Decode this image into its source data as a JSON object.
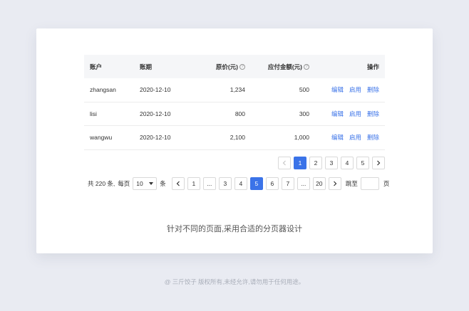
{
  "table": {
    "headers": {
      "account": "账户",
      "period": "账期",
      "original_price": "原价(元)",
      "payable": "应付金额(元)",
      "actions": "操作"
    },
    "help_icon": "question-circle-icon",
    "rows": [
      {
        "account": "zhangsan",
        "period": "2020-12-10",
        "original_price": "1,234",
        "payable": "500"
      },
      {
        "account": "lisi",
        "period": "2020-12-10",
        "original_price": "800",
        "payable": "300"
      },
      {
        "account": "wangwu",
        "period": "2020-12-10",
        "original_price": "2,100",
        "payable": "1,000"
      }
    ],
    "action_labels": {
      "edit": "编辑",
      "enable": "启用",
      "delete": "删除"
    }
  },
  "pager_simple": {
    "prev_icon": "chevron-left-icon",
    "next_icon": "chevron-right-icon",
    "pages": [
      "1",
      "2",
      "3",
      "4",
      "5"
    ],
    "current": "1"
  },
  "pager_full": {
    "total_text": "共 220 条,",
    "per_page_label": "每页",
    "page_size": "10",
    "per_unit": "条",
    "pages": [
      "1",
      "...",
      "3",
      "4",
      "5",
      "6",
      "7",
      "...",
      "20"
    ],
    "current": "5",
    "jump_label": "跳至",
    "jump_unit": "页",
    "jump_value": ""
  },
  "caption": "针对不同的页面,采用合适的分页器设计",
  "footer": "@ 三斤饺子  版权所有,未经允许,请勿用于任何用途。",
  "colors": {
    "accent": "#3b73e8",
    "background": "#e9ebf2"
  }
}
